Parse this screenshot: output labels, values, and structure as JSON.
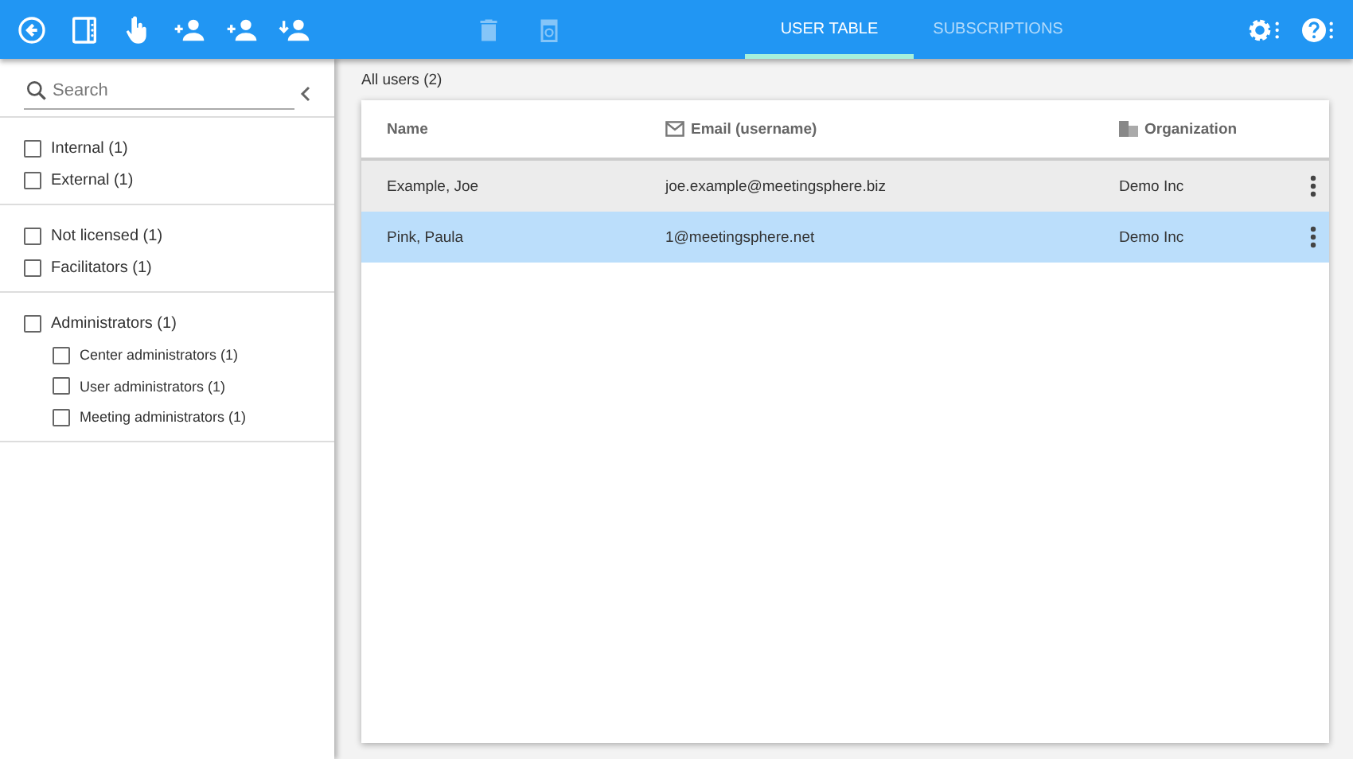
{
  "toolbar": {
    "left": [
      {
        "kind": "back",
        "disabled": false
      },
      {
        "kind": "panel",
        "disabled": false
      },
      {
        "kind": "hand",
        "disabled": false
      },
      {
        "kind": "add-user",
        "disabled": false
      },
      {
        "kind": "add-user",
        "disabled": false
      },
      {
        "kind": "import-user",
        "disabled": false
      }
    ],
    "middle": [
      {
        "kind": "trash",
        "disabled": true
      },
      {
        "kind": "bin",
        "disabled": true
      }
    ],
    "right": [
      {
        "kind": "gear"
      },
      {
        "kind": "help"
      }
    ]
  },
  "tabs": [
    {
      "label": "USER TABLE",
      "selected": true
    },
    {
      "label": "SUBSCRIPTIONS",
      "selected": false
    }
  ],
  "sidebar": {
    "search": {
      "placeholder": "Search"
    },
    "groups": [
      {
        "items": [
          {
            "label": "Internal (1)",
            "checked": false
          },
          {
            "label": "External (1)",
            "checked": false
          }
        ]
      },
      {
        "items": [
          {
            "label": "Not licensed (1)",
            "checked": false
          },
          {
            "label": "Facilitators (1)",
            "checked": false
          }
        ]
      },
      {
        "items": [
          {
            "label": "Administrators (1)",
            "checked": false,
            "children": [
              {
                "label": "Center administrators (1)",
                "checked": false
              },
              {
                "label": "User administrators (1)",
                "checked": false
              },
              {
                "label": "Meeting administrators (1)",
                "checked": false
              }
            ]
          }
        ]
      }
    ]
  },
  "table": {
    "title": "All users (2)",
    "columns": [
      {
        "label": "Name"
      },
      {
        "label": "Email (username)"
      },
      {
        "label": "Organization"
      }
    ],
    "rows": [
      {
        "name": "Example, Joe",
        "email": "joe.example@meetingsphere.biz",
        "organization": "Demo Inc",
        "selected": false,
        "hovered": true
      },
      {
        "name": "Pink, Paula",
        "email": "1@meetingsphere.net",
        "organization": "Demo Inc",
        "selected": true
      }
    ]
  }
}
